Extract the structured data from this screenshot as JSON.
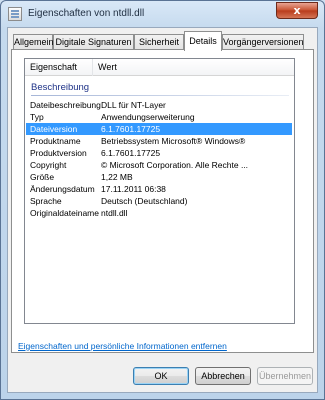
{
  "window": {
    "title": "Eigenschaften von ntdll.dll",
    "close_label": "x"
  },
  "tabs": [
    {
      "label": "Allgemein"
    },
    {
      "label": "Digitale Signaturen"
    },
    {
      "label": "Sicherheit"
    },
    {
      "label": "Details"
    },
    {
      "label": "Vorgängerversionen"
    }
  ],
  "list": {
    "col_property": "Eigenschaft",
    "col_value": "Wert",
    "group": "Beschreibung",
    "rows": [
      {
        "name": "Dateibeschreibung",
        "value": "DLL für NT-Layer"
      },
      {
        "name": "Typ",
        "value": "Anwendungserweiterung"
      },
      {
        "name": "Dateiversion",
        "value": "6.1.7601.17725"
      },
      {
        "name": "Produktname",
        "value": "Betriebssystem Microsoft® Windows®"
      },
      {
        "name": "Produktversion",
        "value": "6.1.7601.17725"
      },
      {
        "name": "Copyright",
        "value": "© Microsoft Corporation. Alle Rechte ..."
      },
      {
        "name": "Größe",
        "value": "1,22 MB"
      },
      {
        "name": "Änderungsdatum",
        "value": "17.11.2011 06:38"
      },
      {
        "name": "Sprache",
        "value": "Deutsch (Deutschland)"
      },
      {
        "name": "Originaldateiname",
        "value": "ntdll.dll"
      }
    ]
  },
  "link": "Eigenschaften und persönliche Informationen entfernen",
  "buttons": {
    "ok": "OK",
    "cancel": "Abbrechen",
    "apply": "Übernehmen"
  },
  "colors": {
    "selection": "#3399ff",
    "group_header": "#1e3287",
    "link": "#0066cc"
  }
}
